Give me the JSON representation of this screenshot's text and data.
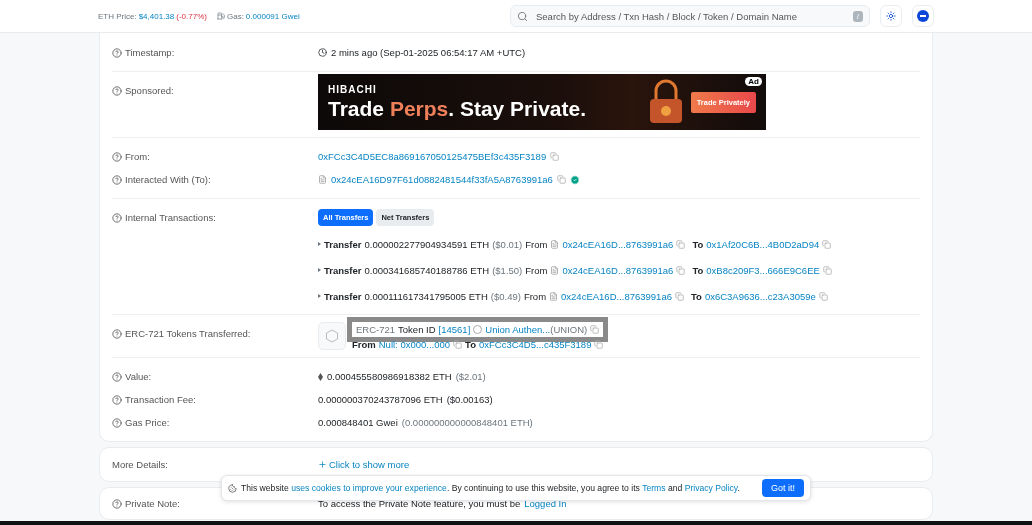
{
  "topbar": {
    "eth_label": "ETH Price:",
    "eth_price": "$4,401.38",
    "eth_change": "(-0.77%)",
    "gas_label": "Gas:",
    "gas_value": "0.000091 Gwei",
    "search": {
      "placeholder": "Search by Address / Txn Hash / Block / Token / Domain Name",
      "shortcut": "/"
    }
  },
  "timestamp": {
    "label": "Timestamp:",
    "value": "2 mins ago (Sep-01-2025 06:54:17 AM +UTC)"
  },
  "sponsored": {
    "label": "Sponsored:",
    "ad": {
      "brand": "HIBACHI",
      "headline": [
        {
          "text": "Trade ",
          "accent": false
        },
        {
          "text": "Perps",
          "accent": true
        },
        {
          "text": ". Stay Private.",
          "accent": false
        }
      ],
      "cta": "Trade Privately",
      "badge": "Ad"
    }
  },
  "from": {
    "label": "From:",
    "address": "0xFCc3C4D5EC8a869167050125475BEf3c435F3189"
  },
  "to": {
    "label": "Interacted With (To):",
    "address": "0x24cEA16D97F61d0882481544f33fA5A8763991a6",
    "verified": true
  },
  "internal": {
    "label": "Internal Transactions:",
    "tabs": [
      {
        "label": "All Transfers",
        "selected": true
      },
      {
        "label": "Net Transfers",
        "selected": false
      }
    ],
    "transfers": [
      {
        "label": "Transfer",
        "amount": "0.000002277904934591 ETH",
        "usd": "($0.01)",
        "from_label": "From",
        "from": "0x24cEA16D...8763991a6",
        "to_label": "To",
        "to": "0x1Af20C6B...4B0D2aD94"
      },
      {
        "label": "Transfer",
        "amount": "0.000341685740188786 ETH",
        "usd": "($1.50)",
        "from_label": "From",
        "from": "0x24cEA16D...8763991a6",
        "to_label": "To",
        "to": "0xB8c209F3...666E9C6EE"
      },
      {
        "label": "Transfer",
        "amount": "0.000111617341795005 ETH",
        "usd": "($0.49)",
        "from_label": "From",
        "from": "0x24cEA16D...8763991a6",
        "to_label": "To",
        "to": "0x6C3A9636...c23A3059e"
      }
    ]
  },
  "erc721": {
    "label": "ERC-721 Tokens Transferred:",
    "standard": "ERC-721",
    "token_id_label": "Token ID",
    "token_id": "[14561]",
    "token_name": "Union Authen...",
    "token_symbol": "(UNION)",
    "from_label": "From",
    "from": "Null: 0x000...000",
    "to_label": "To",
    "to": "0xFCc3C4D5...c435F3189"
  },
  "value": {
    "label": "Value:",
    "amount": "0.000455580986918382 ETH",
    "usd": "($2.01)"
  },
  "fee": {
    "label": "Transaction Fee:",
    "amount": "0.000000370243787096 ETH",
    "usd": "($0.00163)"
  },
  "gas_price": {
    "label": "Gas Price:",
    "amount": "0.000848401 Gwei",
    "eth": "(0.000000000000848401 ETH)"
  },
  "more": {
    "label": "More Details:",
    "link": "Click to show more"
  },
  "private_note": {
    "label": "Private Note:",
    "text": "To access the Private Note feature, you must be",
    "link": "Logged In"
  },
  "cookie": {
    "before": "This website",
    "link1": "uses cookies to improve your experience",
    "middle": ". By continuing to use this website, you agree to its",
    "terms": "Terms",
    "and": "and",
    "privacy": "Privacy Policy",
    "end": ".",
    "button": "Got it!"
  }
}
